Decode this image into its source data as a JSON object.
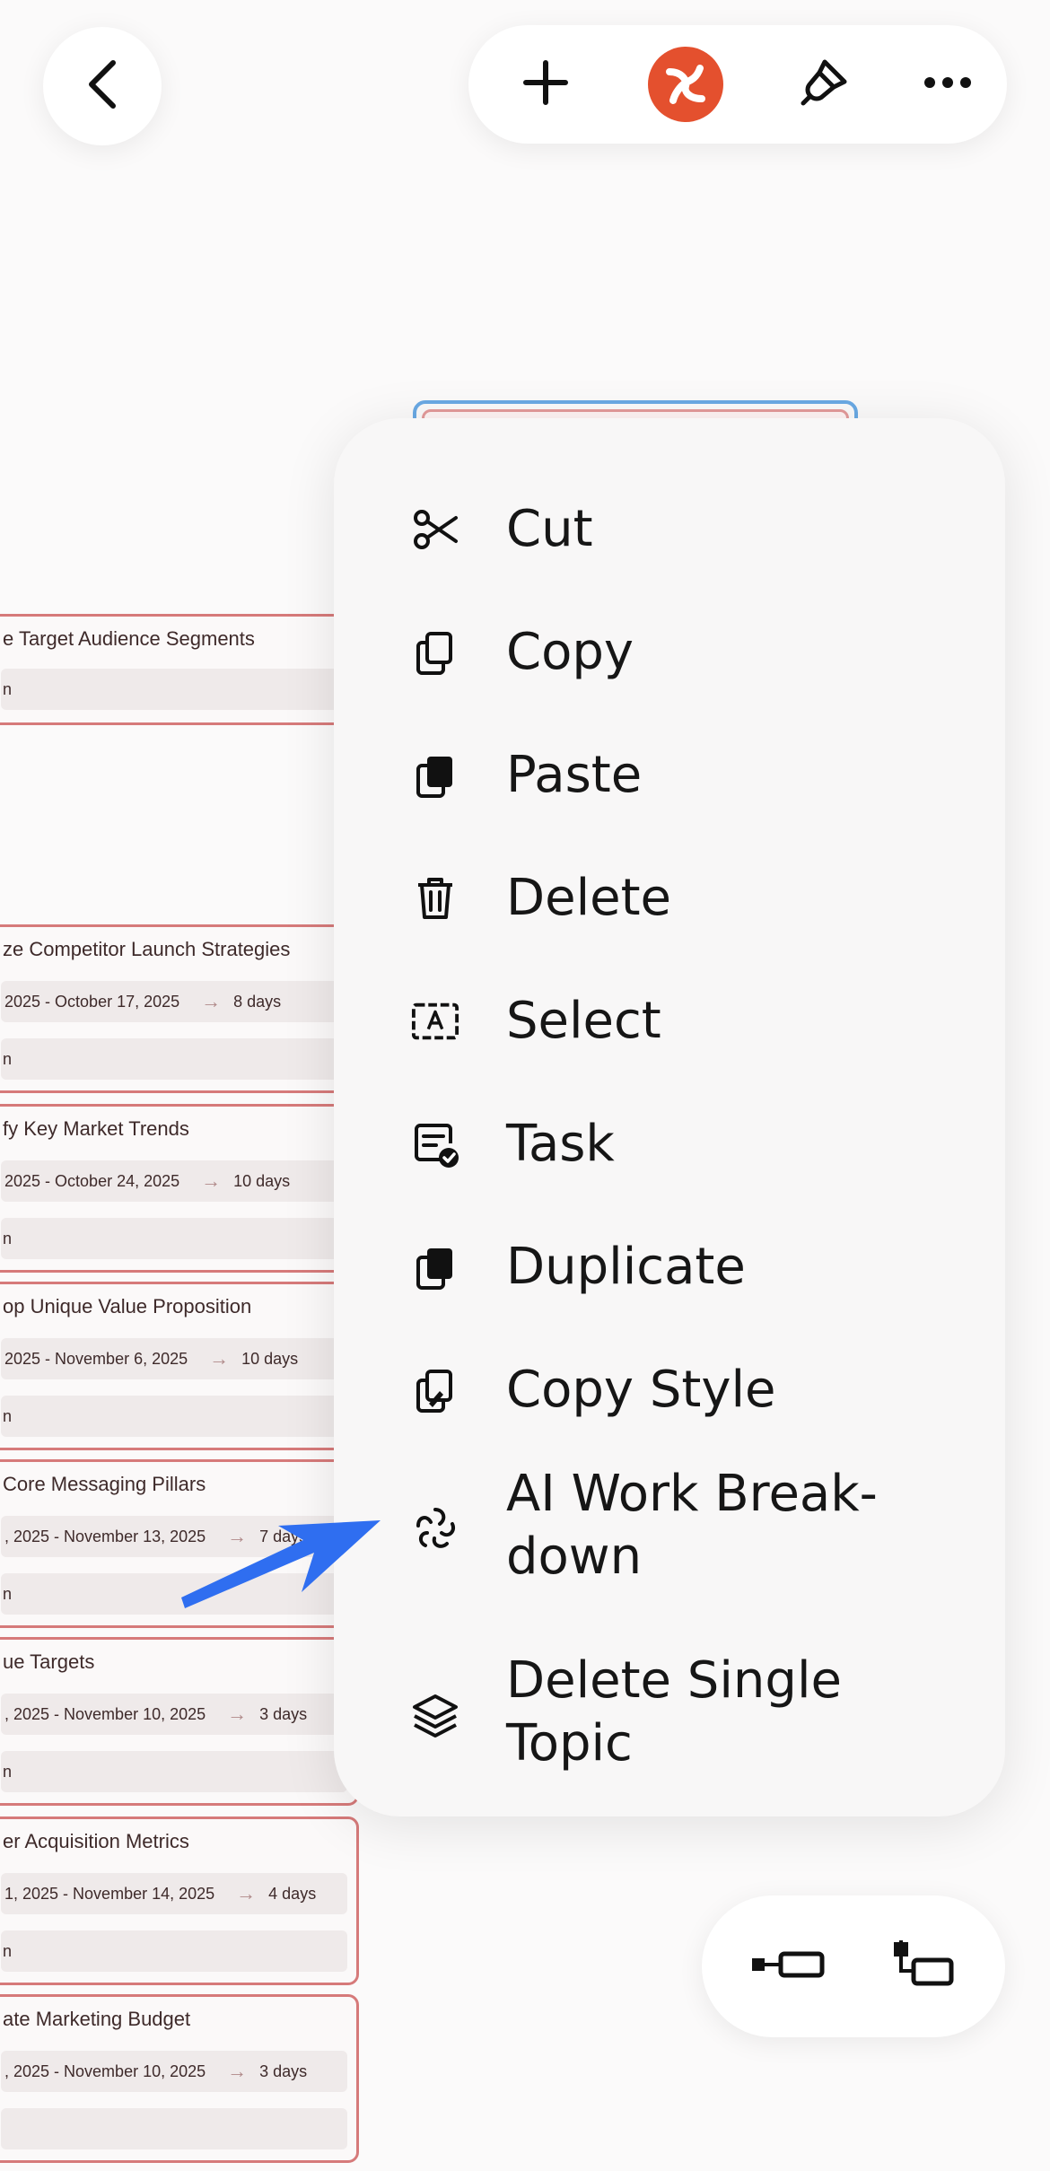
{
  "toolbar": {
    "back_icon": "chevron-left-icon",
    "add_icon": "plus-icon",
    "logo_icon": "app-logo-icon",
    "style_icon": "paint-brush-icon",
    "more_icon": "more-horizontal-icon"
  },
  "canvas": {
    "topics": [
      {
        "title": "e Target Audience Segments",
        "pill2": "n"
      },
      {
        "title": "ze Competitor Launch Strategies",
        "dates": "2025 - October 17, 2025",
        "arrow": "→",
        "days": "8 days",
        "pill2": "n"
      },
      {
        "title": "fy Key Market Trends",
        "dates": "2025 - October 24, 2025",
        "arrow": "→",
        "days": "10 days",
        "pill2": "n"
      },
      {
        "title": "op Unique Value Proposition",
        "dates": "2025 - November 6, 2025",
        "arrow": "→",
        "days": "10 days",
        "pill2": "n"
      },
      {
        "title": "Core Messaging Pillars",
        "dates": ", 2025 - November 13, 2025",
        "arrow": "→",
        "days": "7 days",
        "pill2": "n"
      },
      {
        "title": "ue Targets",
        "dates": ", 2025 - November 10, 2025",
        "arrow": "→",
        "days": "3 days",
        "pill2": "n"
      },
      {
        "title": "er Acquisition Metrics",
        "dates": "1, 2025 - November 14, 2025",
        "arrow": "→",
        "days": "4 days",
        "pill2": "n"
      },
      {
        "title": "ate Marketing Budget",
        "dates": ", 2025 - November 10, 2025",
        "arrow": "→",
        "days": "3 days",
        "pill2": ""
      }
    ]
  },
  "menu": {
    "items": [
      {
        "label": "Cut",
        "icon": "scissors-icon"
      },
      {
        "label": "Copy",
        "icon": "copy-icon"
      },
      {
        "label": "Paste",
        "icon": "paste-icon"
      },
      {
        "label": "Delete",
        "icon": "trash-icon"
      },
      {
        "label": "Select",
        "icon": "select-text-icon"
      },
      {
        "label": "Task",
        "icon": "task-icon"
      },
      {
        "label": "Duplicate",
        "icon": "duplicate-icon"
      },
      {
        "label": "Copy Style",
        "icon": "copy-style-icon"
      },
      {
        "label_line1": "AI Work Break-",
        "label_line2": "down",
        "icon": "ai-sparkle-icon"
      },
      {
        "label_line1": "Delete Single",
        "label_line2": "Topic",
        "icon": "layers-icon"
      }
    ]
  },
  "layout_control": {
    "left_icon": "layout-horizontal-icon",
    "right_icon": "layout-tree-icon"
  },
  "colors": {
    "accent_blue": "#2f6ef0",
    "node_border": "#d67a7a",
    "selected_border": "#6aa9e4",
    "logo": "#e4502e"
  }
}
